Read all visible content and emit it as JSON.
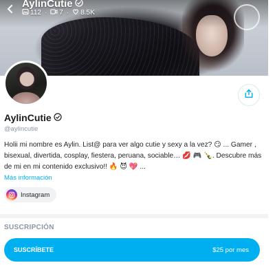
{
  "header": {
    "title": "AylinCutie",
    "stats": {
      "photos": "112",
      "videos": "7",
      "likes": "8.5K"
    }
  },
  "profile": {
    "name": "AylinCutie",
    "handle": "@aylincutie",
    "bio": "Holii mi nombre es Aylin. List@ para ver algo cutie y sexy a la vez? 😏 ... Gamer , bisexual, divertida, cosplay, fiestera, peruana, sociable… 💋 🎮 🍾. Descubre más de mi en mi contenido exclusivo!! 🔥 😈 💖 ...",
    "more_info": "Más información",
    "social": {
      "instagram": "Instagram"
    }
  },
  "subscription": {
    "section_label": "SUSCRIPCIÓN",
    "button_label": "SUSCRÍBETE",
    "price": "$25 por mes"
  },
  "colors": {
    "accent": "#00aff0",
    "muted": "#8a96a3",
    "chip_bg": "#f0f2f4"
  }
}
